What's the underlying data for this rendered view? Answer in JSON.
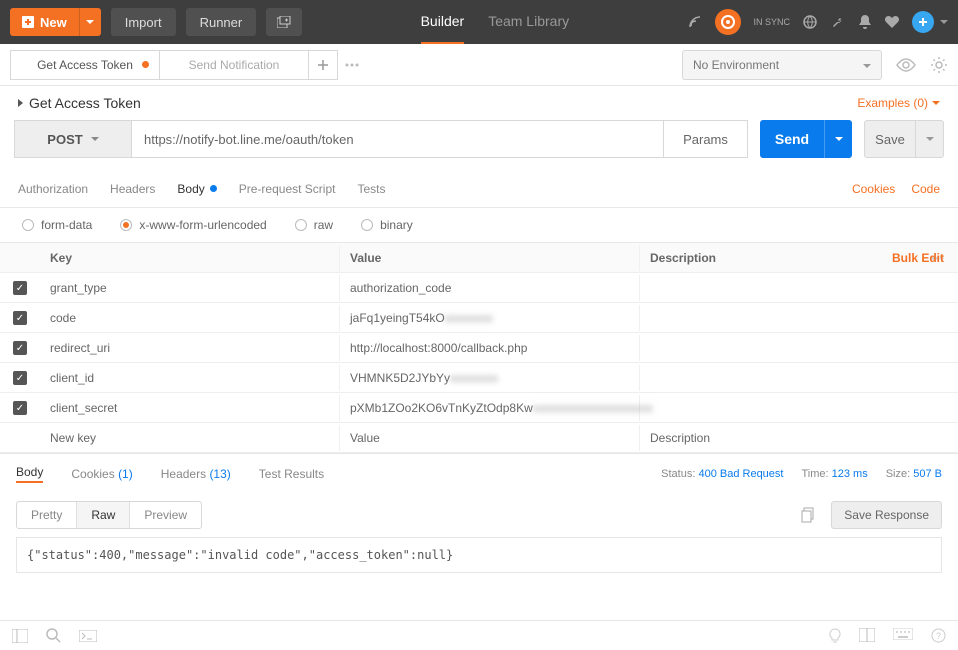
{
  "header": {
    "new_label": "New",
    "import_label": "Import",
    "runner_label": "Runner",
    "nav_builder": "Builder",
    "nav_team_library": "Team Library",
    "sync_label": "IN SYNC"
  },
  "tabs": {
    "items": [
      {
        "label": "Get Access Token",
        "dirty": true
      },
      {
        "label": "Send Notification",
        "dirty": false
      }
    ],
    "environment_placeholder": "No Environment"
  },
  "request": {
    "title": "Get Access Token",
    "examples_label": "Examples (0)",
    "method": "POST",
    "url": "https://notify-bot.line.me/oauth/token",
    "params_label": "Params",
    "send_label": "Send",
    "save_label": "Save"
  },
  "subtabs": {
    "authorization": "Authorization",
    "headers": "Headers",
    "body": "Body",
    "prerequest": "Pre-request Script",
    "tests": "Tests",
    "cookies": "Cookies",
    "code": "Code"
  },
  "bodytype": {
    "form_data": "form-data",
    "urlencoded": "x-www-form-urlencoded",
    "raw": "raw",
    "binary": "binary"
  },
  "params_table": {
    "header_key": "Key",
    "header_value": "Value",
    "header_description": "Description",
    "bulk_edit": "Bulk Edit",
    "new_key": "New key",
    "new_value": "Value",
    "new_description": "Description",
    "rows": [
      {
        "key": "grant_type",
        "value": "authorization_code",
        "blur": ""
      },
      {
        "key": "code",
        "value": "jaFq1yeingT54kO",
        "blur": "xxxxxxxx"
      },
      {
        "key": "redirect_uri",
        "value": "http://localhost:8000/callback.php",
        "blur": ""
      },
      {
        "key": "client_id",
        "value": "VHMNK5D2JYbYy",
        "blur": "xxxxxxxx"
      },
      {
        "key": "client_secret",
        "value": "pXMb1ZOo2KO6vTnKyZtOdp8Kw",
        "blur": "xxxxxxxxxxxxxxxxxxxx"
      }
    ]
  },
  "response": {
    "tab_body": "Body",
    "tab_cookies": "Cookies",
    "tab_cookies_count": "(1)",
    "tab_headers": "Headers",
    "tab_headers_count": "(13)",
    "tab_tests": "Test Results",
    "status_label": "Status:",
    "status_value": "400 Bad Request",
    "time_label": "Time:",
    "time_value": "123 ms",
    "size_label": "Size:",
    "size_value": "507 B",
    "view_pretty": "Pretty",
    "view_raw": "Raw",
    "view_preview": "Preview",
    "save_response": "Save Response",
    "body_text": "{\"status\":400,\"message\":\"invalid code\",\"access_token\":null}"
  }
}
